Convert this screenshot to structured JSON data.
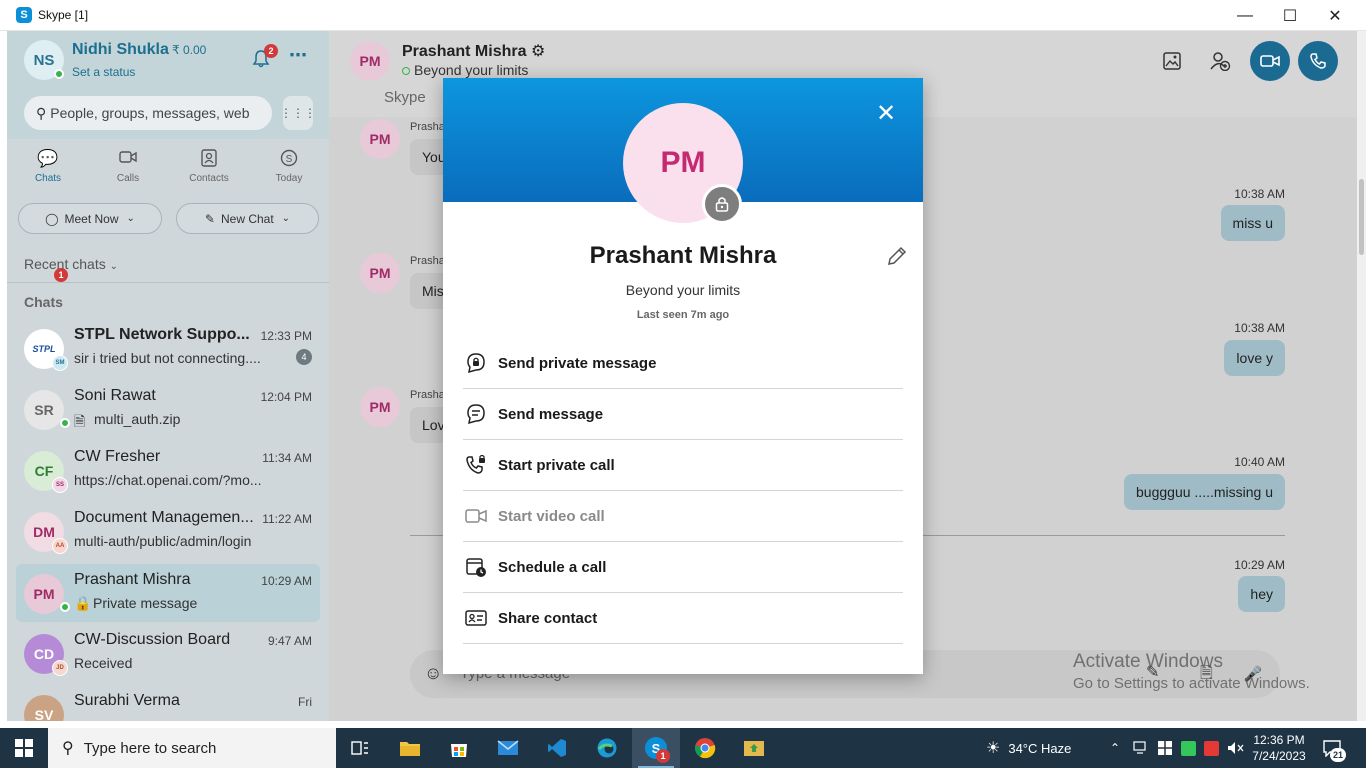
{
  "window": {
    "title": "Skype [1]",
    "app_initial": "S"
  },
  "profile": {
    "initials": "NS",
    "name": "Nidhi Shukla",
    "credit": "₹ 0.00",
    "status": "Set a status",
    "notifications": "2"
  },
  "search": {
    "placeholder": "People, groups, messages, web"
  },
  "nav": {
    "chats": "Chats",
    "chats_badge": "1",
    "calls": "Calls",
    "contacts": "Contacts",
    "today": "Today"
  },
  "actions": {
    "meet_now": "Meet Now",
    "new_chat": "New Chat"
  },
  "sections": {
    "recent": "Recent chats",
    "chats": "Chats"
  },
  "chat_list": [
    {
      "initials": "STPL",
      "name": "STPL Network Suppo...",
      "time": "12:33 PM",
      "preview": "sir i tried but not connecting....",
      "unread": "4",
      "mini": "SM"
    },
    {
      "initials": "SR",
      "name": "Soni Rawat",
      "time": "12:04 PM",
      "preview": "multi_auth.zip"
    },
    {
      "initials": "CF",
      "name": "CW Fresher",
      "time": "11:34 AM",
      "preview": "https://chat.openai.com/?mo...",
      "mini": "SS"
    },
    {
      "initials": "DM",
      "name": "Document Managemen...",
      "time": "11:22 AM",
      "preview": "multi-auth/public/admin/login",
      "mini": "AA"
    },
    {
      "initials": "PM",
      "name": "Prashant Mishra",
      "time": "10:29 AM",
      "preview": "Private message"
    },
    {
      "initials": "CD",
      "name": "CW-Discussion Board",
      "time": "9:47 AM",
      "preview": "Received",
      "mini": "JD"
    },
    {
      "initials": "SV",
      "name": "Surabhi Verma",
      "time": "Fri",
      "preview": ""
    }
  ],
  "conversation": {
    "initials": "PM",
    "name": "Prashant Mishra",
    "status": "Beyond your limits",
    "sub_tab": "Skype",
    "incoming_name": "Prasha",
    "incoming": [
      "You",
      "Mis",
      "Lov"
    ],
    "outgoing": [
      {
        "time": "10:38 AM",
        "text": "miss  u"
      },
      {
        "time": "10:38 AM",
        "text": "love y"
      },
      {
        "time": "10:40 AM",
        "text": "buggguu .....missing u"
      },
      {
        "time": "10:29 AM",
        "text": "hey"
      }
    ],
    "composer_placeholder": "Type a message"
  },
  "watermark": {
    "line1": "Activate Windows",
    "line2": "Go to Settings to activate Windows."
  },
  "modal": {
    "initials": "PM",
    "name": "Prashant Mishra",
    "status": "Beyond your limits",
    "last_seen": "Last seen 7m ago",
    "items": [
      {
        "label": "Send private message",
        "icon": "private-chat-icon"
      },
      {
        "label": "Send message",
        "icon": "chat-bubble-icon"
      },
      {
        "label": "Start private call",
        "icon": "private-call-icon"
      },
      {
        "label": "Start video call",
        "icon": "video-icon",
        "disabled": true
      },
      {
        "label": "Schedule a call",
        "icon": "calendar-clock-icon"
      },
      {
        "label": "Share contact",
        "icon": "contact-card-icon"
      }
    ]
  },
  "taskbar": {
    "search_placeholder": "Type here to search",
    "skype_badge": "1",
    "weather": "34°C  Haze",
    "time": "12:36 PM",
    "date": "7/24/2023",
    "notif_count": "21"
  },
  "colors": {
    "accent": "#1a6a92",
    "modal_header": "#0a7fd0",
    "taskbar": "#1e3343"
  }
}
